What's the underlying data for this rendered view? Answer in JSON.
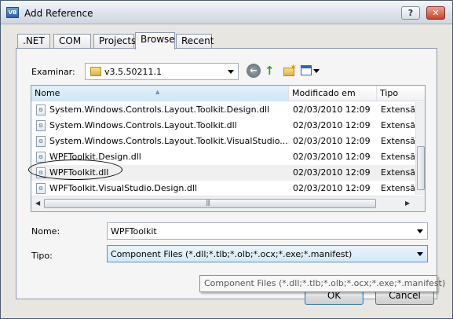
{
  "window": {
    "title": "Add Reference",
    "icon_label": "VB",
    "help_label": "?",
    "close_label": "✕"
  },
  "tabs": [
    {
      "label": ".NET"
    },
    {
      "label": "COM"
    },
    {
      "label": "Projects"
    },
    {
      "label": "Browse",
      "active": true
    },
    {
      "label": "Recent"
    }
  ],
  "browse": {
    "look_in_label": "Examinar:",
    "look_in_value": "v3.5.50211.1",
    "columns": [
      "Nome",
      "Modificado em",
      "Tipo"
    ],
    "rows": [
      {
        "name": "System.Windows.Controls.Layout.Toolkit.Design.dll",
        "modified": "02/03/2010 12:09",
        "type": "Extensão"
      },
      {
        "name": "System.Windows.Controls.Layout.Toolkit.dll",
        "modified": "02/03/2010 12:09",
        "type": "Extensão"
      },
      {
        "name": "System.Windows.Controls.Layout.Toolkit.VisualStudio....",
        "modified": "02/03/2010 12:09",
        "type": "Extensão"
      },
      {
        "name": "WPFToolkit.Design.dll",
        "modified": "02/03/2010 12:09",
        "type": "Extensão"
      },
      {
        "name": "WPFToolkit.dll",
        "modified": "02/03/2010 12:09",
        "type": "Extensão",
        "selected": true
      },
      {
        "name": "WPFToolkit.VisualStudio.Design.dll",
        "modified": "02/03/2010 12:09",
        "type": "Extensão"
      }
    ],
    "filename_label": "Nome:",
    "filename_value": "WPFToolkit",
    "filetype_label": "Tipo:",
    "filetype_value": "Component Files (*.dll;*.tlb;*.olb;*.ocx;*.exe;*.manifest)"
  },
  "tooltip": "Component Files (*.dll;*.tlb;*.olb;*.ocx;*.exe;*.manifest)",
  "buttons": {
    "ok": "OK",
    "cancel": "Cancel"
  },
  "icons": {
    "back": "back-icon",
    "up": "up-folder-icon",
    "new_folder": "new-folder-icon",
    "views": "views-menu-icon",
    "file": "dll-file-icon"
  }
}
